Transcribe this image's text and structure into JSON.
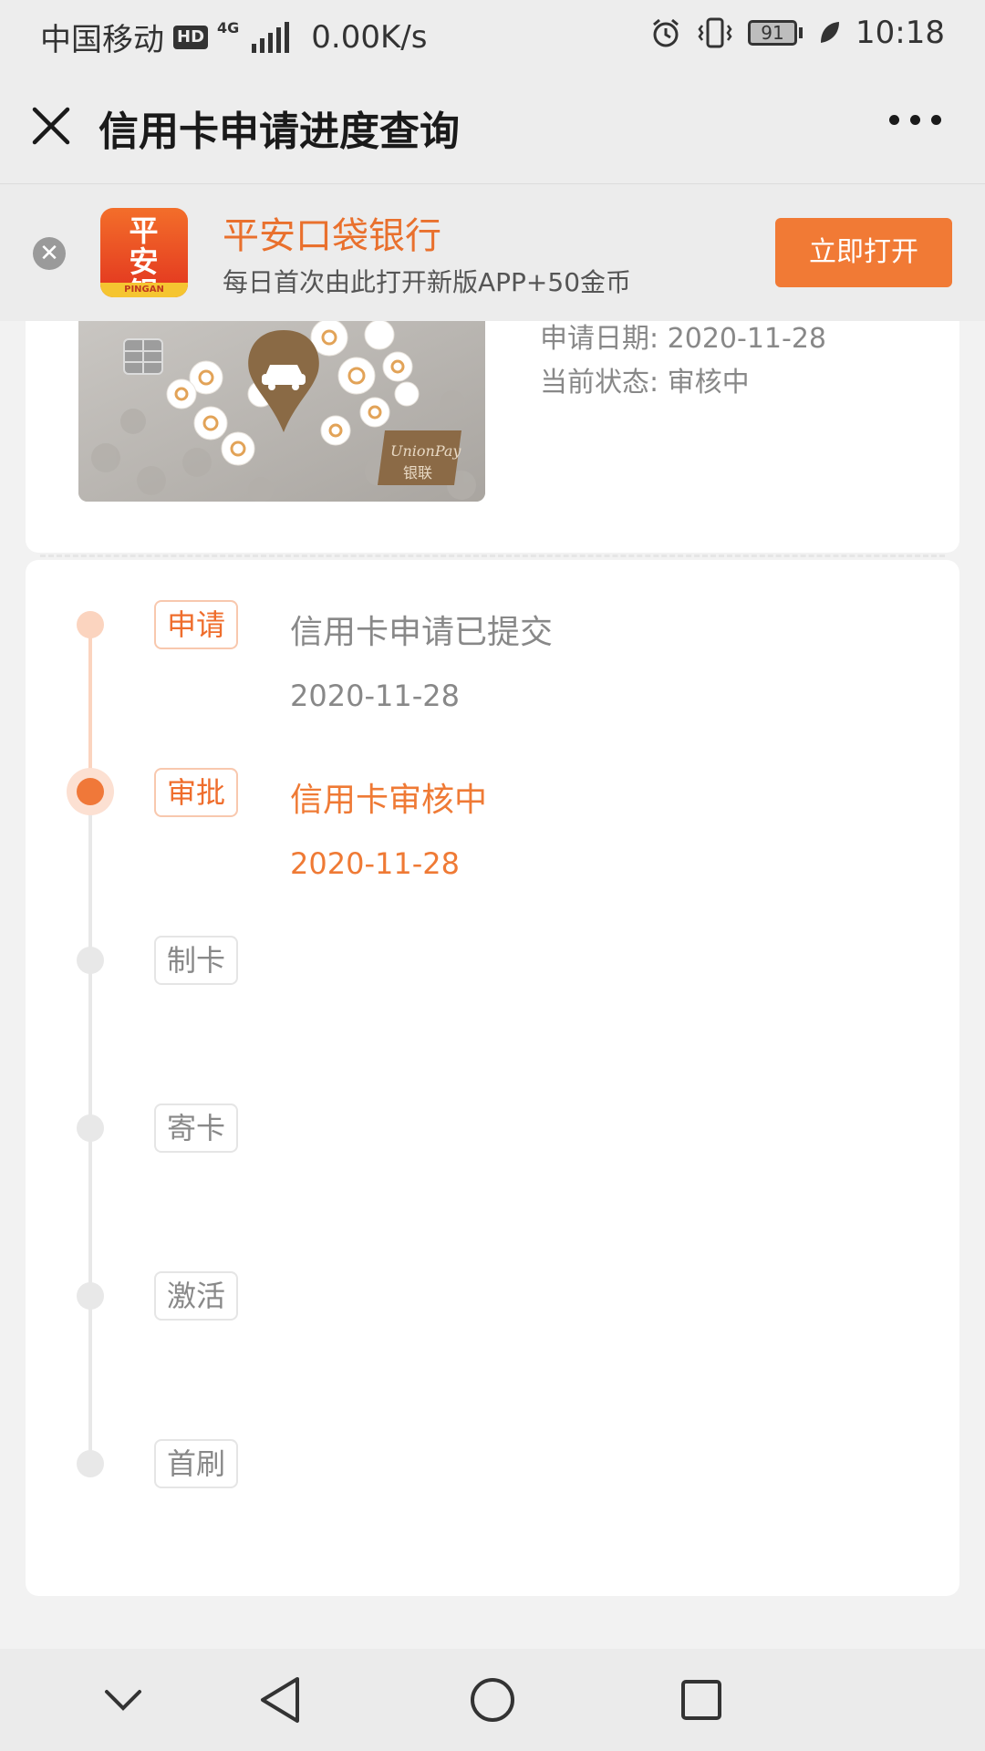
{
  "status_bar": {
    "carrier": "中国移动",
    "hd": "HD",
    "network": "4G",
    "speed": "0.00K/s",
    "battery": "91",
    "time": "10:18"
  },
  "header": {
    "title": "信用卡申请进度查询"
  },
  "banner": {
    "app_logo_text": "平安银行",
    "app_logo_strip": "PINGAN",
    "app_name": "平安口袋银行",
    "subtitle": "每日首次由此打开新版APP+50金币",
    "open_button": "立即打开"
  },
  "card_info": {
    "apply_date_label": "申请日期:",
    "apply_date_value": "2020-11-28",
    "status_label": "当前状态:",
    "status_value": "审核中",
    "unionpay_text": "UnionPay",
    "unionpay_cn": "银联"
  },
  "timeline": [
    {
      "tag": "申请",
      "title": "信用卡申请已提交",
      "date": "2020-11-28",
      "state": "done"
    },
    {
      "tag": "审批",
      "title": "信用卡审核中",
      "date": "2020-11-28",
      "state": "active"
    },
    {
      "tag": "制卡",
      "title": "",
      "date": "",
      "state": "todo"
    },
    {
      "tag": "寄卡",
      "title": "",
      "date": "",
      "state": "todo"
    },
    {
      "tag": "激活",
      "title": "",
      "date": "",
      "state": "todo"
    },
    {
      "tag": "首刷",
      "title": "",
      "date": "",
      "state": "todo"
    }
  ],
  "nav": {
    "icons": [
      "chevron-down-icon",
      "back-icon",
      "home-icon",
      "recents-icon"
    ]
  },
  "colors": {
    "accent": "#ef7a35",
    "accent_light": "#fbd4bf",
    "inactive": "#e8e8e8"
  }
}
